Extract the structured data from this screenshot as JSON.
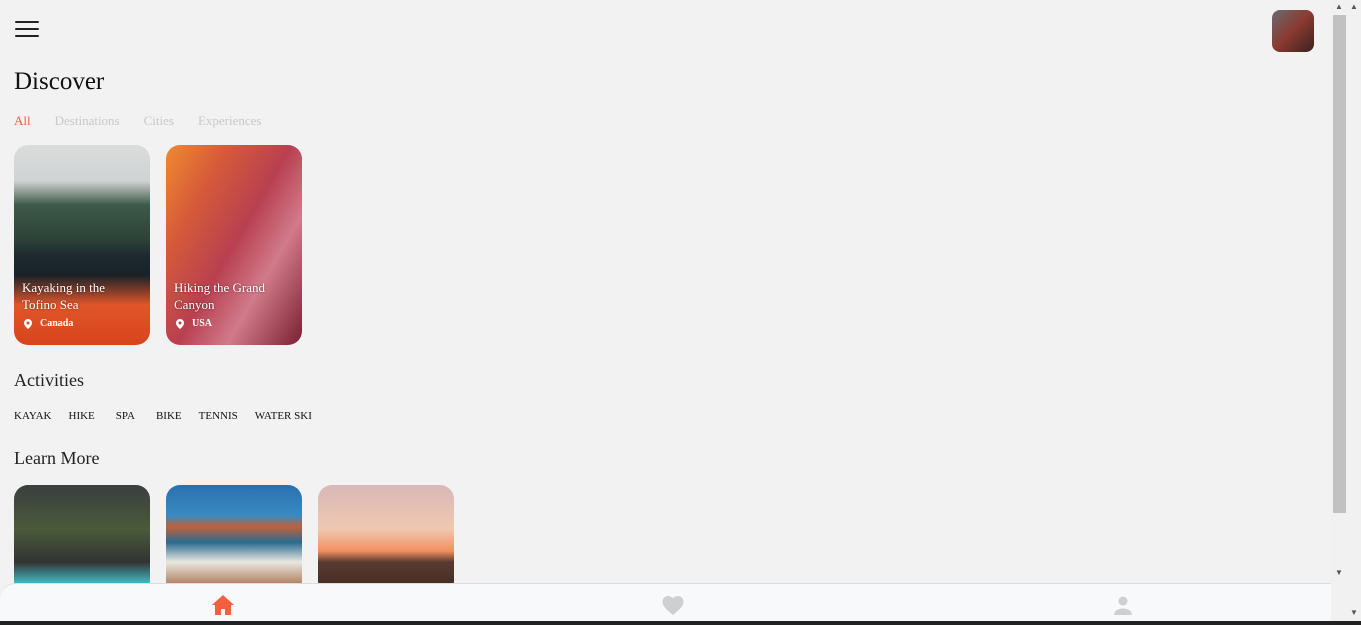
{
  "header": {
    "menu_icon": "hamburger-icon",
    "avatar": "user-avatar"
  },
  "title": "Discover",
  "tabs": [
    {
      "label": "All",
      "active": true
    },
    {
      "label": "Destinations"
    },
    {
      "label": "Cities"
    },
    {
      "label": "Experiences"
    }
  ],
  "discover_cards": [
    {
      "title": "Kayaking in the Tofino Sea",
      "location": "Canada"
    },
    {
      "title": "Hiking the Grand Canyon",
      "location": "USA"
    }
  ],
  "activities": {
    "heading": "Activities",
    "items": [
      "KAYAK",
      "HIKE",
      "SPA",
      "BIKE",
      "TENNIS",
      "WATER SKI"
    ]
  },
  "learn_more": {
    "heading": "Learn More"
  },
  "bottom_nav": [
    {
      "icon": "home-icon",
      "active": true
    },
    {
      "icon": "heart-icon"
    },
    {
      "icon": "user-icon"
    }
  ],
  "colors": {
    "accent": "#f4603e",
    "inactive": "#c8c8c8"
  }
}
